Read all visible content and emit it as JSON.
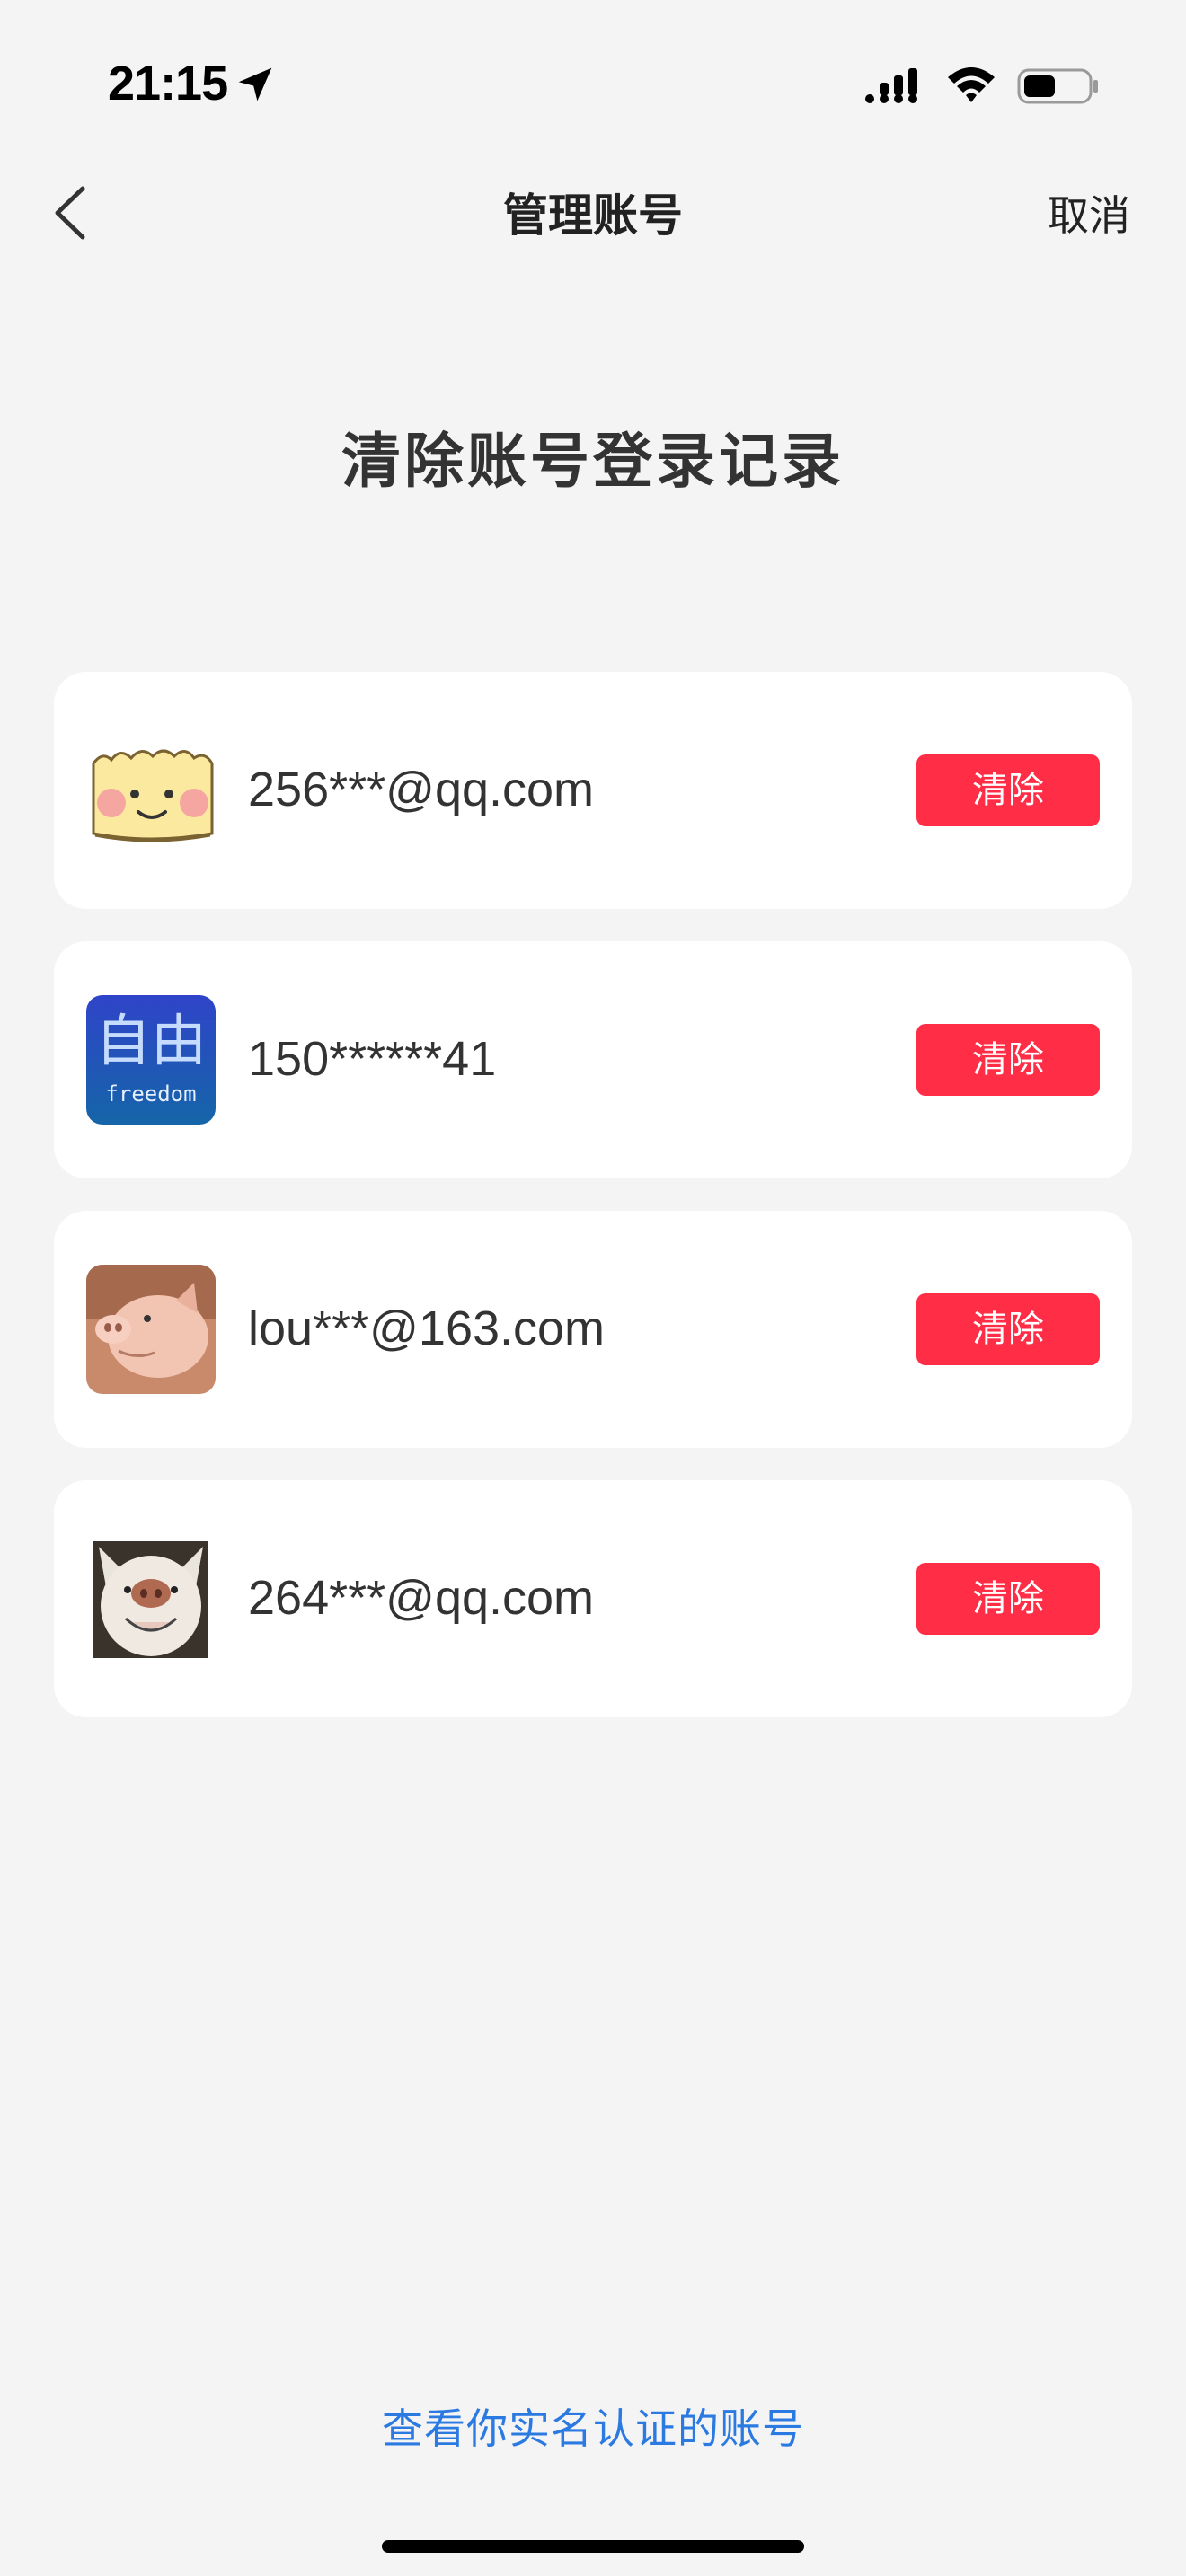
{
  "status_bar": {
    "time": "21:15"
  },
  "nav": {
    "title": "管理账号",
    "cancel_label": "取消"
  },
  "heading": "清除账号登录记录",
  "accounts": [
    {
      "name": "256***@qq.com",
      "clear_label": "清除",
      "avatar": "cartoon-face-avatar"
    },
    {
      "name": "150******41",
      "clear_label": "清除",
      "avatar": "freedom-avatar",
      "avatar_text_cn": "自由",
      "avatar_text_en": "freedom"
    },
    {
      "name": "lou***@163.com",
      "clear_label": "清除",
      "avatar": "piglet-avatar"
    },
    {
      "name": "264***@qq.com",
      "clear_label": "清除",
      "avatar": "dog-avatar"
    }
  ],
  "footer_link": "查看你实名认证的账号",
  "colors": {
    "clear_button": "#ff2d46",
    "link": "#2a7ae2",
    "background": "#f4f4f4"
  }
}
